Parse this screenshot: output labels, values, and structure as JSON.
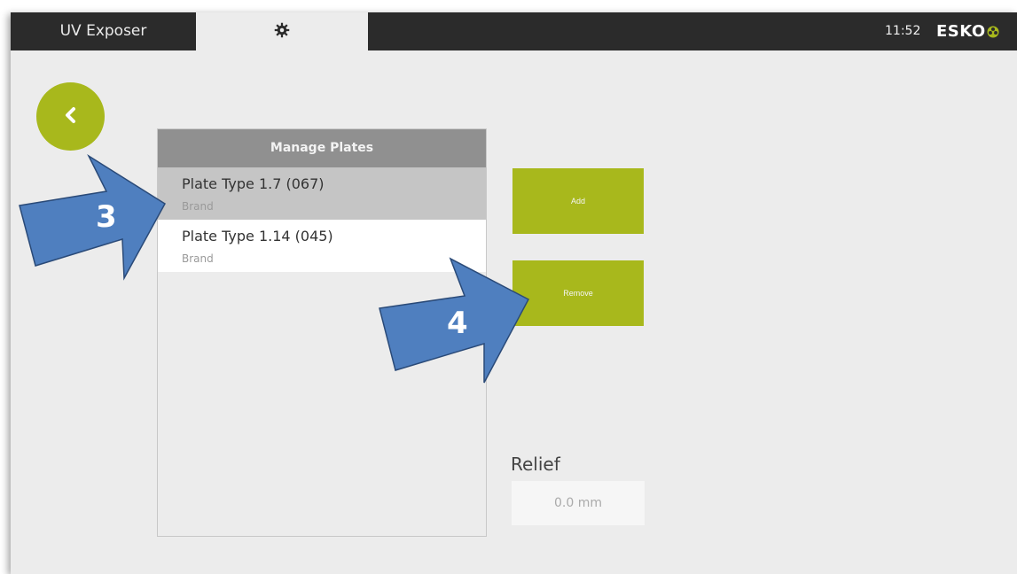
{
  "topbar": {
    "app_tab_label": "UV Exposer",
    "settings_icon": "gear-icon",
    "clock": "11:52",
    "logo_text": "ESKO",
    "logo_icon": "esko-flower-icon",
    "logo_accent": "#a8b81c"
  },
  "back_button": {
    "icon": "chevron-left-icon",
    "color": "#a8b81c"
  },
  "plates_panel": {
    "title": "Manage Plates",
    "items": [
      {
        "name": "Plate Type 1.7 (067)",
        "brand": "Brand",
        "selected": true
      },
      {
        "name": "Plate Type 1.14 (045)",
        "brand": "Brand",
        "selected": false
      }
    ]
  },
  "actions": {
    "add_label": "Add",
    "remove_label": "Remove",
    "color": "#a8b81c"
  },
  "relief": {
    "label": "Relief",
    "value": "0.0 mm"
  },
  "annotations": [
    {
      "number": "3",
      "color": "#4f7fbf"
    },
    {
      "number": "4",
      "color": "#4f7fbf"
    }
  ]
}
